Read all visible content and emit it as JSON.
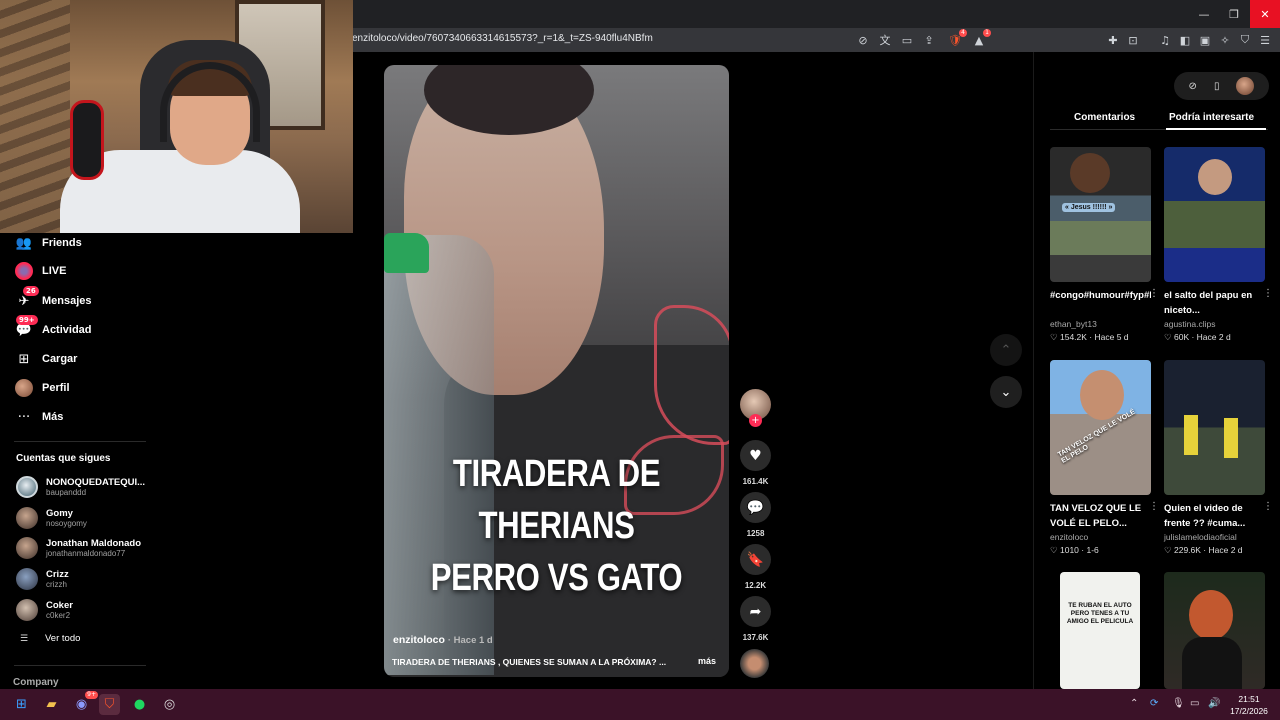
{
  "browser": {
    "url": "enzitoloco/video/7607340663314615573?_r=1&_t=ZS-940flu4NBfm",
    "window_controls": {
      "minimize": "—",
      "restore": "❐",
      "close": "✕"
    },
    "brave_shield_badge": "4",
    "notify_badge": "1"
  },
  "sidebar": {
    "items": [
      {
        "label": "Friends",
        "icon": "friends-icon",
        "glyph": "👥"
      },
      {
        "label": "LIVE",
        "icon": "live-icon",
        "glyph": ""
      },
      {
        "label": "Mensajes",
        "icon": "messages-icon",
        "glyph": "✈",
        "badge": "26"
      },
      {
        "label": "Actividad",
        "icon": "activity-icon",
        "glyph": "💬",
        "badge": "99+"
      },
      {
        "label": "Cargar",
        "icon": "upload-icon",
        "glyph": "⊞"
      },
      {
        "label": "Perfil",
        "icon": "profile-icon",
        "glyph": ""
      },
      {
        "label": "Más",
        "icon": "more-icon",
        "glyph": "···"
      }
    ],
    "following_title": "Cuentas que sigues",
    "following": [
      {
        "name": "NONOQUEDATEQUI...",
        "handle": "baupanddd"
      },
      {
        "name": "Gomy",
        "handle": "nosoygomy"
      },
      {
        "name": "Jonathan Maldonado",
        "handle": "jonathanmaldonado77"
      },
      {
        "name": "Crizz",
        "handle": "crizzh"
      },
      {
        "name": "Coker",
        "handle": "c0ker2"
      }
    ],
    "see_all": "Ver todo",
    "company": "Company"
  },
  "video": {
    "caption_lines": [
      "TIRADERA DE",
      "THERIANS",
      "PERRO VS GATO"
    ],
    "author": "enzitoloco",
    "posted": "Hace 1 d",
    "description": "TIRADERA DE THERIANS , QUIENES SE SUMAN A LA PRÓXIMA? ...",
    "more": "más"
  },
  "actions": {
    "likes": "161.4K",
    "comments": "1258",
    "saves": "12.2K",
    "shares": "137.6K"
  },
  "right_panel": {
    "tabs": [
      "Comentarios",
      "Podría interesarte"
    ],
    "active_tab": "Podría interesarte",
    "cards": [
      {
        "title": "#congo#humour#fyp#bus",
        "user": "ethan_byt13",
        "likes": "154.2K",
        "when": "Hace 5 d"
      },
      {
        "title": "el salto del papu en niceto...",
        "user": "agustina.clips",
        "likes": "60K",
        "when": "Hace 2 d"
      },
      {
        "title": "TAN VELOZ QUE LE VOLÉ EL PELO...",
        "user": "enzitoloco",
        "likes": "1010",
        "when": "1-6"
      },
      {
        "title": "Quien el video de frente ?? #cuma...",
        "user": "julislamelodiaoficial",
        "likes": "229.6K",
        "when": "Hace 2 d"
      }
    ],
    "thumb_texts": {
      "c1": "« Jesus !!!!!! »",
      "c3": "TAN VELOZ QUE LE VOLÉ EL PELO",
      "c5": "TE RUBAN EL AUTO PERO TENES A TU AMIGO EL PELICULA"
    }
  },
  "taskbar": {
    "time": "21:51",
    "date": "17/2/2026",
    "discord_badge": "9+"
  },
  "colors": {
    "accent": "#fe2c55",
    "taskbar": "#3b1228",
    "background": "#000000"
  }
}
